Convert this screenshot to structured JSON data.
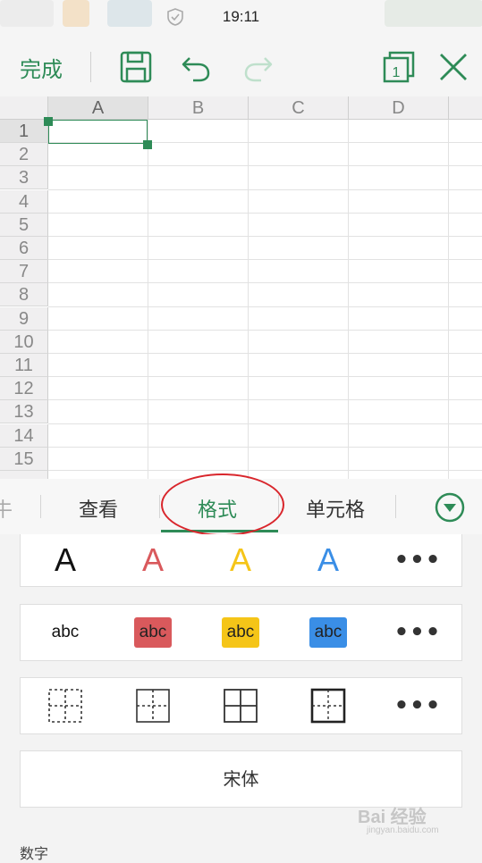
{
  "status_bar": {
    "time": "19:11"
  },
  "toolbar": {
    "done_label": "完成",
    "icons": [
      "save-icon",
      "undo-icon",
      "redo-icon",
      "sheet-switch-icon",
      "close-icon"
    ],
    "sheet_number": "1"
  },
  "sheet": {
    "columns": [
      "A",
      "B",
      "C",
      "D"
    ],
    "rows": [
      "1",
      "2",
      "3",
      "4",
      "5",
      "6",
      "7",
      "8",
      "9",
      "10",
      "11",
      "12",
      "13",
      "14",
      "15"
    ],
    "selected_cell": "A1"
  },
  "tabs": {
    "items": [
      {
        "label": "查看"
      },
      {
        "label": "格式"
      },
      {
        "label": "单元格"
      }
    ],
    "active": "格式",
    "partial_left": "牛"
  },
  "format_panel": {
    "font_color_letter": "A",
    "font_colors": [
      "#111111",
      "#d9595c",
      "#f5c518",
      "#3a8ee6"
    ],
    "fill_text": "abc",
    "fill_colors": [
      "#ffffff",
      "#d9595c",
      "#f5c518",
      "#3a8ee6"
    ],
    "more_symbol": "•••",
    "border_styles": [
      "dashed-border-icon",
      "inner-border-icon",
      "all-border-icon",
      "outer-border-icon"
    ],
    "font_name": "宋体",
    "section_number_label": "数字"
  },
  "watermark": {
    "text": "Bai 经验",
    "sub": "jingyan.baidu.com"
  },
  "colors": {
    "accent": "#2e8b57",
    "annotation": "#d9262c"
  }
}
